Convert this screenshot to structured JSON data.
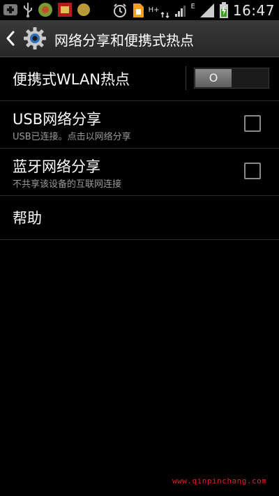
{
  "status_bar": {
    "time": "16:47",
    "network_type_label": "H+",
    "secondary_network_label": "E",
    "icons": [
      "add-notification-icon",
      "usb-icon",
      "app-notification-icon",
      "game-notification-icon",
      "coin-notification-icon",
      "alarm-icon",
      "sim-card-icon",
      "mobile-data-icon",
      "signal-icon",
      "signal-icon-2",
      "battery-charging-icon"
    ]
  },
  "header": {
    "title": "网络分享和便携式热点",
    "back_icon": "back-arrow-icon",
    "app_icon": "settings-gear-icon"
  },
  "settings": {
    "hotspot": {
      "label": "便携式WLAN热点",
      "toggle_state": "O"
    },
    "usb": {
      "label": "USB网络分享",
      "summary": "USB已连接。点击以网络分享",
      "checked": false
    },
    "bluetooth": {
      "label": "蓝牙网络分享",
      "summary": "不共享该设备的互联网连接",
      "checked": false
    },
    "help": {
      "label": "帮助"
    }
  },
  "watermark": {
    "text": "www.qinpinchang.com"
  },
  "colors": {
    "background": "#000000",
    "title_bar": "#2f2f2f",
    "summary_text": "#9a9a9a",
    "divider": "#2e2e2e",
    "watermark": "#e02020"
  }
}
